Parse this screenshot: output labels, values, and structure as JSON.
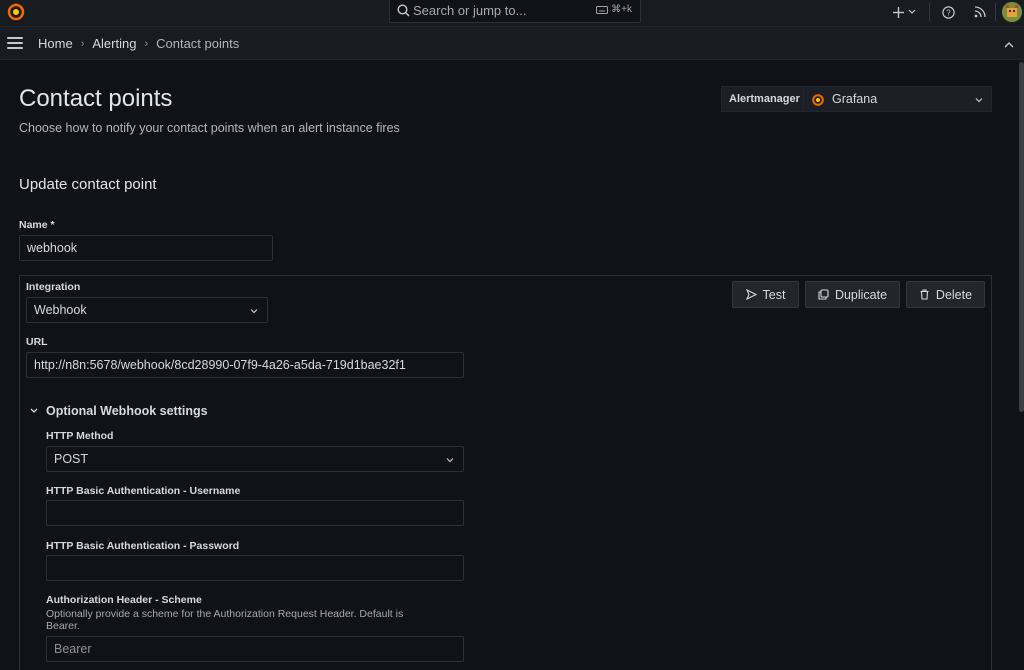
{
  "topbar": {
    "search_placeholder": "Search or jump to...",
    "search_shortcut": "⌘+k",
    "add_icon": "plus-icon",
    "help_icon": "help-circle-icon",
    "news_icon": "rss-icon"
  },
  "breadcrumb": {
    "home": "Home",
    "alerting": "Alerting",
    "current": "Contact points"
  },
  "page": {
    "title": "Contact points",
    "subtitle": "Choose how to notify your contact points when an alert instance fires"
  },
  "alertmanager": {
    "label": "Alertmanager",
    "selected": "Grafana"
  },
  "form": {
    "heading": "Update contact point",
    "name_label": "Name *",
    "name_value": "webhook",
    "integration_label": "Integration",
    "integration_value": "Webhook",
    "url_label": "URL",
    "url_value": "http://n8n:5678/webhook/8cd28990-07f9-4a26-a5da-719d1bae32f1",
    "buttons": {
      "test": "Test",
      "duplicate": "Duplicate",
      "delete": "Delete"
    },
    "optional_section": "Optional Webhook settings",
    "http_method_label": "HTTP Method",
    "http_method_value": "POST",
    "basic_user_label": "HTTP Basic Authentication - Username",
    "basic_user_value": "",
    "basic_pass_label": "HTTP Basic Authentication - Password",
    "basic_pass_value": "",
    "auth_scheme_label": "Authorization Header - Scheme",
    "auth_scheme_desc": "Optionally provide a scheme for the Authorization Request Header. Default is Bearer.",
    "auth_scheme_placeholder": "Bearer"
  },
  "colors": {
    "background": "#111217",
    "panel": "#181b1f",
    "text": "#d8d9e0",
    "brand_orange": "#f46800"
  }
}
